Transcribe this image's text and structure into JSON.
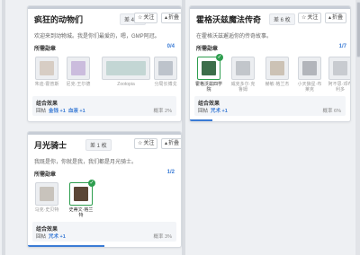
{
  "cards": [
    {
      "title": "疯狂的动物们",
      "count": "差 4 枚",
      "follow": "关注",
      "fold": "折叠",
      "desc": "欢迎来到动物城。我是你们最爱的，嗯，GMP阿冠。",
      "section_label": "所需勋章",
      "section_count": "0/4",
      "items": [
        {
          "name": "朱迪·霍普斯",
          "owned": false,
          "color": "#c9b8a6"
        },
        {
          "name": "尼克·王尔德",
          "owned": false,
          "color": "#b59bd1"
        },
        {
          "name": "Zootopia",
          "owned": false,
          "color": "#a9c7c2"
        },
        {
          "name": "分局长博戈",
          "owned": false,
          "color": "#9fa6b3"
        }
      ],
      "bonus_title": "组合效果",
      "bonus_effect": "回帖",
      "bonus_values": [
        "金钱 +1",
        "血液 +1"
      ],
      "bonus_pct": "概率 2%"
    },
    {
      "title": "霍格沃兹魔法传奇",
      "count": "差 6 枚",
      "follow": "关注",
      "fold": "折叠",
      "desc": "在霍格沃兹邂逅你的传奇故事。",
      "section_label": "所需勋章",
      "section_count": "1/7",
      "items": [
        {
          "name": "霍格沃兹四学院",
          "owned": true,
          "color": "#3c6e4a"
        },
        {
          "name": "威克多尔·克鲁姆",
          "owned": false,
          "color": "#a7abb2"
        },
        {
          "name": "赫敏·格兰杰",
          "owned": false,
          "color": "#b7a58e"
        },
        {
          "name": "小天狼星·布莱克",
          "owned": false,
          "color": "#8c9098"
        },
        {
          "name": "阿不思·邓布利多",
          "owned": false,
          "color": "#b0b4bb"
        }
      ],
      "bonus_title": "组合效果",
      "bonus_effect": "回帖",
      "bonus_values": [
        "咒术 +1"
      ],
      "bonus_pct": "概率 6%"
    },
    {
      "title": "月光骑士",
      "count": "差 1 枚",
      "follow": "关注",
      "fold": "折叠",
      "desc": "我既是你，你就是我，我们都是月光骑士。",
      "section_label": "所需勋章",
      "section_count": "1/2",
      "items": [
        {
          "name": "马克·史贝特",
          "owned": false,
          "color": "#b0a79a"
        },
        {
          "name": "史蒂文·格兰特",
          "owned": true,
          "color": "#5b4636"
        }
      ],
      "bonus_title": "组合效果",
      "bonus_effect": "回帖",
      "bonus_values": [
        "咒术 +1"
      ],
      "bonus_pct": "概率 3%"
    }
  ]
}
